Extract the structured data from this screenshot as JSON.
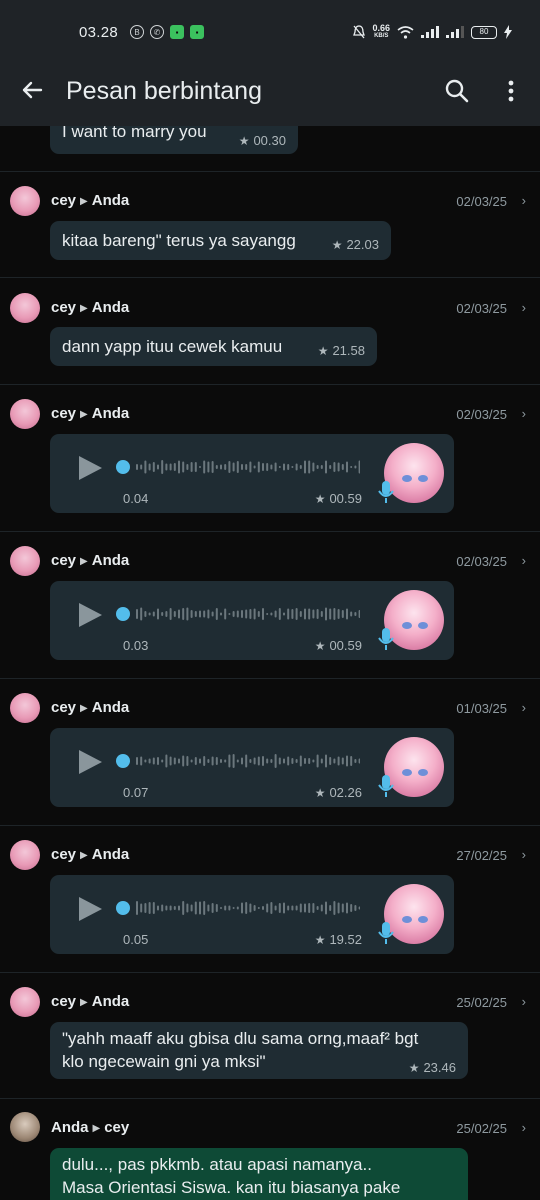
{
  "status_bar": {
    "time": "03.28",
    "speed_value": "0.66",
    "speed_unit": "KB/S",
    "battery": "80"
  },
  "app_bar": {
    "title": "Pesan berbintang"
  },
  "messages": [
    {
      "type": "text",
      "text": "I want to marry you",
      "time": "00.30"
    },
    {
      "type": "text",
      "from": "cey",
      "to": "Anda",
      "date": "02/03/25",
      "text": "kitaa bareng\" terus ya sayangg",
      "time": "22.03"
    },
    {
      "type": "text",
      "from": "cey",
      "to": "Anda",
      "date": "02/03/25",
      "text": "dann yapp ituu cewek kamuu",
      "time": "21.58"
    },
    {
      "type": "voice",
      "from": "cey",
      "to": "Anda",
      "date": "02/03/25",
      "duration": "0.04",
      "time": "00.59"
    },
    {
      "type": "voice",
      "from": "cey",
      "to": "Anda",
      "date": "02/03/25",
      "duration": "0.03",
      "time": "00.59"
    },
    {
      "type": "voice",
      "from": "cey",
      "to": "Anda",
      "date": "01/03/25",
      "duration": "0.07",
      "time": "02.26"
    },
    {
      "type": "voice",
      "from": "cey",
      "to": "Anda",
      "date": "27/02/25",
      "duration": "0.05",
      "time": "19.52"
    },
    {
      "type": "text",
      "from": "cey",
      "to": "Anda",
      "date": "25/02/25",
      "text_line1": "\"yahh maaff aku gbisa dlu sama orng,maaf² bgt",
      "text_line2": "klo ngecewain gni ya mksi\"",
      "time": "23.46"
    },
    {
      "type": "text",
      "from": "Anda",
      "to": "cey",
      "date": "25/02/25",
      "text_line1": "dulu..., pas pkkmb. atau apasi namanya..",
      "text_line2": "Masa Orientasi Siswa. kan itu biasanya pake",
      "outgoing": true
    }
  ],
  "colors": {
    "background": "#0b0b0b",
    "bar": "#1f2327",
    "incoming_bubble": "#1f2c33",
    "outgoing_bubble": "#0e4a36",
    "voice_accent": "#53bdeb"
  }
}
